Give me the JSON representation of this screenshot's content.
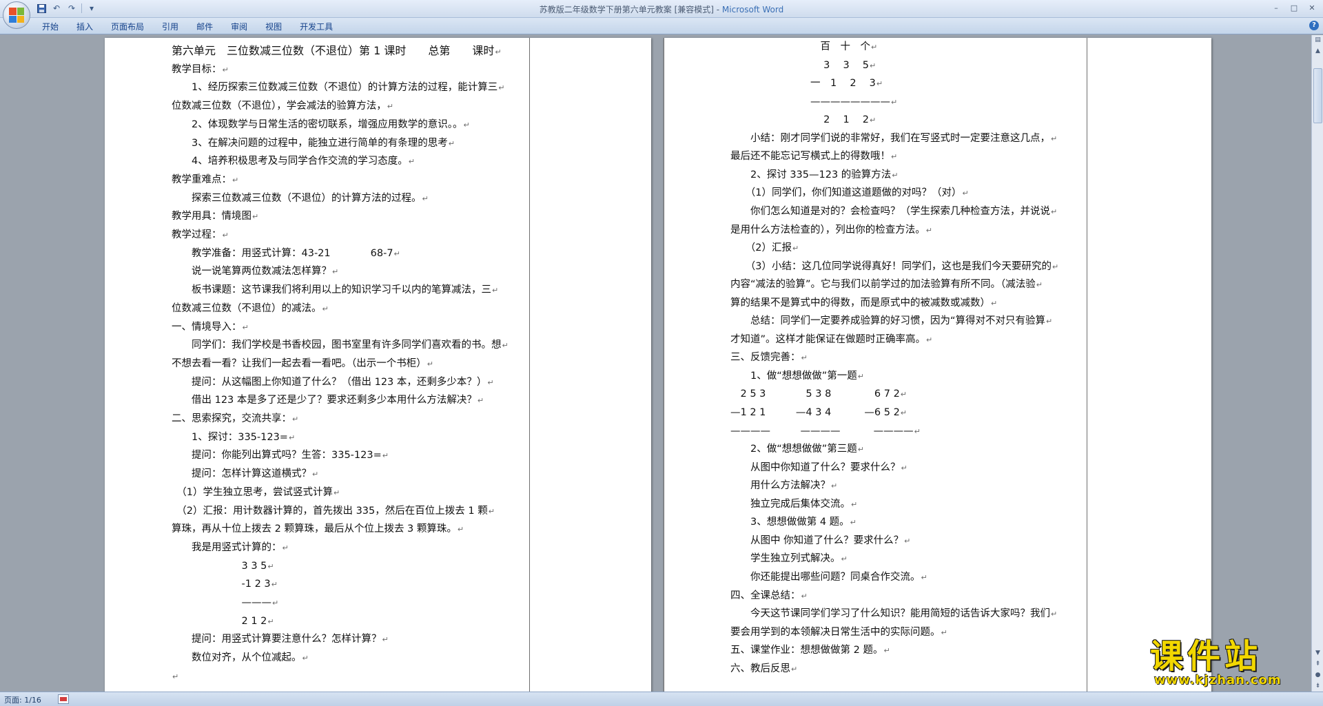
{
  "window": {
    "title_doc": "苏教版二年级数学下册第六单元教案 [兼容模式] - ",
    "title_app": "Microsoft Word",
    "controls": [
      "–",
      "□",
      "✕"
    ]
  },
  "quick_access": {
    "save_icon": "save-icon",
    "undo_icon": "undo-icon",
    "redo_icon": "redo-icon",
    "customize_icon": "dropdown-icon"
  },
  "ribbon_tabs": [
    "开始",
    "插入",
    "页面布局",
    "引用",
    "邮件",
    "审阅",
    "视图",
    "开发工具"
  ],
  "paragraph_mark": "↵",
  "page1": {
    "lines": [
      "第六单元　三位数减三位数（不退位）第 1 课时　　总第　　课时",
      "教学目标：",
      "　　1、经历探索三位数减三位数（不退位）的计算方法的过程，能计算三",
      "位数减三位数（不退位），学会减法的验算方法，",
      "　　2、体现数学与日常生活的密切联系，增强应用数学的意识。。",
      "　　3、在解决问题的过程中，能独立进行简单的有条理的思考",
      "　　4、培养积极思考及与同学合作交流的学习态度。",
      "教学重难点：",
      "　　探索三位数减三位数（不退位）的计算方法的过程。",
      "教学用具：情境图",
      "教学过程：",
      "　　教学准备：用竖式计算：43-21　　　　68-7",
      "　　说一说笔算两位数减法怎样算？",
      "　　板书课题：这节课我们将利用以上的知识学习千以内的笔算减法，三",
      "位数减三位数（不退位）的减法。",
      "一、情境导入：",
      "　　同学们：我们学校是书香校园，图书室里有许多同学们喜欢看的书。想",
      "不想去看一看？让我们一起去看一看吧。（出示一个书柜）",
      "　　提问：从这幅图上你知道了什么？（借出 123 本，还剩多少本？）",
      "　　借出 123 本是多了还是少了？要求还剩多少本用什么方法解决？",
      "二、思索探究，交流共享：",
      "　　1、探讨：335-123=",
      "　　提问：你能列出算式吗？生答：335-123=",
      "　　提问：怎样计算这道横式？",
      "　（1）学生独立思考，尝试竖式计算",
      "　（2）汇报：用计数器计算的，首先拨出 335，然后在百位上拨去 1 颗",
      "算珠，再从十位上拨去 2 颗算珠，最后从个位上拨去 3 颗算珠。",
      "　　我是用竖式计算的：",
      "　　　　　　　3 3 5",
      "　　　　　　　-1 2 3",
      "　　　　　　　———",
      "　　　　　　　2 1 2",
      "　　提问：用竖式计算要注意什么？怎样计算？",
      "　　数位对齐，从个位减起。",
      ""
    ]
  },
  "page2": {
    "lines": [
      "　　　　　　　　　百　十　个",
      "　　　　　　　　　 3　 3　 5",
      "　　　　　　　　一　1　 2　 3",
      "　　　　　　　　————————",
      "　　　　　　　　　 2　 1　 2",
      "　　小结：刚才同学们说的非常好，我们在写竖式时一定要注意这几点，",
      "最后还不能忘记写横式上的得数哦！",
      "　　2、探讨 335—123 的验算方法",
      "　　（1）同学们，你们知道这道题做的对吗？（对）",
      "　　你们怎么知道是对的？会检查吗？（学生探索几种检查方法，并说说",
      "是用什么方法检查的），列出你的检查方法。",
      "　　（2）汇报",
      "　　（3）小结：这几位同学说得真好！同学们，这也是我们今天要研究的",
      "内容“减法的验算”。它与我们以前学过的加法验算有所不同。（减法验",
      "算的结果不是算式中的得数，而是原式中的被减数或减数）",
      "　　总结：同学们一定要养成验算的好习惯，因为“算得对不对只有验算",
      "才知道”。这样才能保证在做题时正确率高。",
      "三、反馈完善：",
      "　　1、做“想想做做”第一题",
      "　2 5 3　　　　5 3 8　　　　 6 7 2",
      "—1 2 1　　　—4 3 4　　　 —6 5 2",
      "————　　　————　　　 ————",
      "　　2、做“想想做做”第三题",
      "　　从图中你知道了什么？要求什么？",
      "　　用什么方法解决？",
      "　　独立完成后集体交流。",
      "　　3、想想做做第 4 题。",
      "　　从图中 你知道了什么？要求什么？",
      "　　学生独立列式解决。",
      "　　你还能提出哪些问题？同桌合作交流。",
      "四、全课总结：",
      "　　今天这节课同学们学习了什么知识？能用简短的话告诉大家吗？我们",
      "要会用学到的本领解决日常生活中的实际问题。",
      "五、课堂作业：想想做做第 2 题。",
      "六、教后反思"
    ]
  },
  "statusbar": {
    "page_info": "页面: 1/16"
  },
  "watermark": {
    "name": "课件站",
    "url": "www.kjzhan.com"
  },
  "colors": {
    "title_app": "#3a6fb5",
    "ribbon_text": "#15428b",
    "watermark": "#f2d700"
  }
}
